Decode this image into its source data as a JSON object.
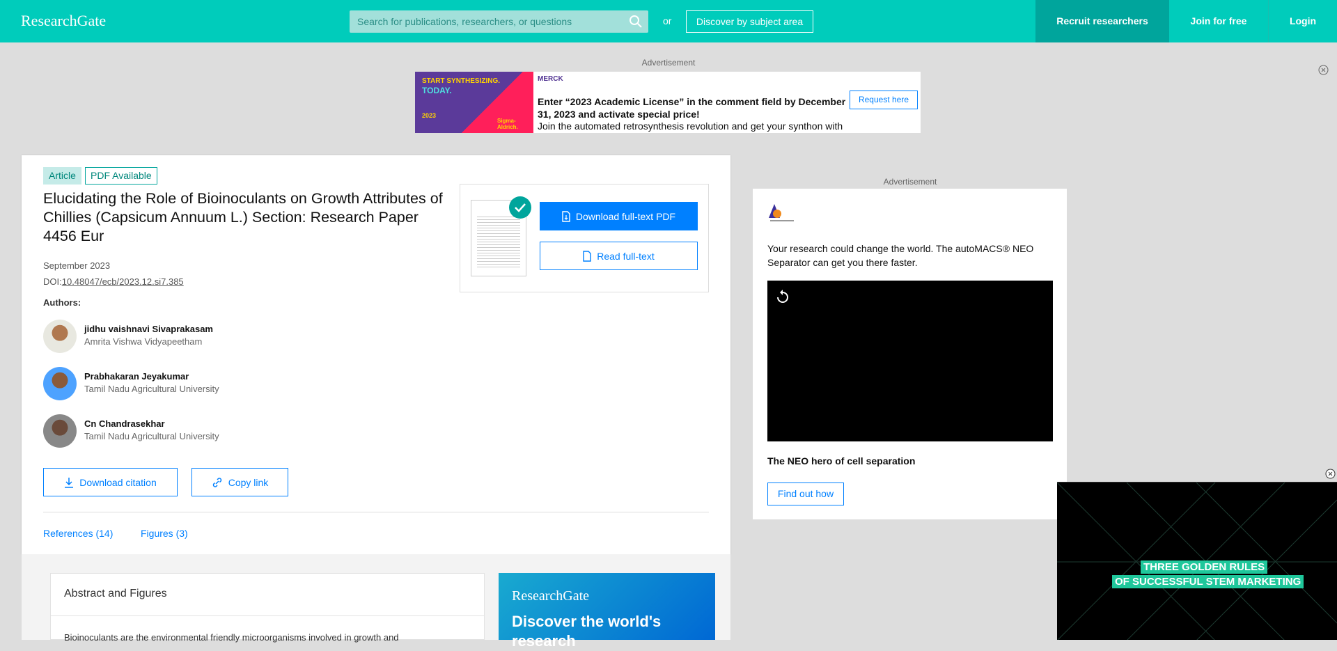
{
  "header": {
    "logo": "ResearchGate",
    "search_placeholder": "Search for publications, researchers, or questions",
    "or": "or",
    "discover": "Discover by subject area",
    "recruit": "Recruit researchers",
    "join": "Join for free",
    "login": "Login",
    "colors": {
      "brand": "#00ccbb",
      "recruit_bg": "#00a59c"
    }
  },
  "top_ad": {
    "label": "Advertisement",
    "brand": "MERCK",
    "image_text": [
      "START SYNTHESIZING.",
      "TODAY.",
      "2023",
      "Sigma-Aldrich."
    ],
    "headline": "Enter “2023 Academic License” in the comment field by December 31, 2023 and activate special price!",
    "body": "Join the automated retrosynthesis revolution and get your synthon with",
    "cta": "Request here"
  },
  "article": {
    "type_badge": "Article",
    "pdf_badge": "PDF Available",
    "title": "Elucidating the Role of Bioinoculants on Growth Attributes of Chillies (Capsicum Annuum L.) Section: Research Paper 4456 Eur",
    "date": "September 2023",
    "doi_prefix": "DOI:",
    "doi": "10.48047/ecb/2023.12.si7.385",
    "authors_label": "Authors:",
    "authors": [
      {
        "name": "jidhu vaishnavi Sivaprakasam",
        "affiliation": "Amrita Vishwa Vidyapeetham"
      },
      {
        "name": "Prabhakaran Jeyakumar",
        "affiliation": "Tamil Nadu Agricultural University"
      },
      {
        "name": "Cn Chandrasekhar",
        "affiliation": "Tamil Nadu Agricultural University"
      }
    ],
    "download_citation": "Download citation",
    "copy_link": "Copy link",
    "download_pdf": "Download full-text PDF",
    "read_fulltext": "Read full-text",
    "tabs": [
      "References (14)",
      "Figures (3)"
    ]
  },
  "abstract": {
    "heading": "Abstract and Figures",
    "text": "Bioinoculants are the environmental friendly microorganisms involved in growth and"
  },
  "promo": {
    "logo": "ResearchGate",
    "headline": "Discover the world's research"
  },
  "side_ad": {
    "label": "Advertisement",
    "text": "Your research could change the world. The autoMACS® NEO Separator can get you there faster.",
    "heading": "The NEO hero of cell separation",
    "cta": "Find out how"
  },
  "video_ad": {
    "line1": "THREE GOLDEN RULES",
    "line2": "OF SUCCESSFUL STEM MARKETING"
  }
}
